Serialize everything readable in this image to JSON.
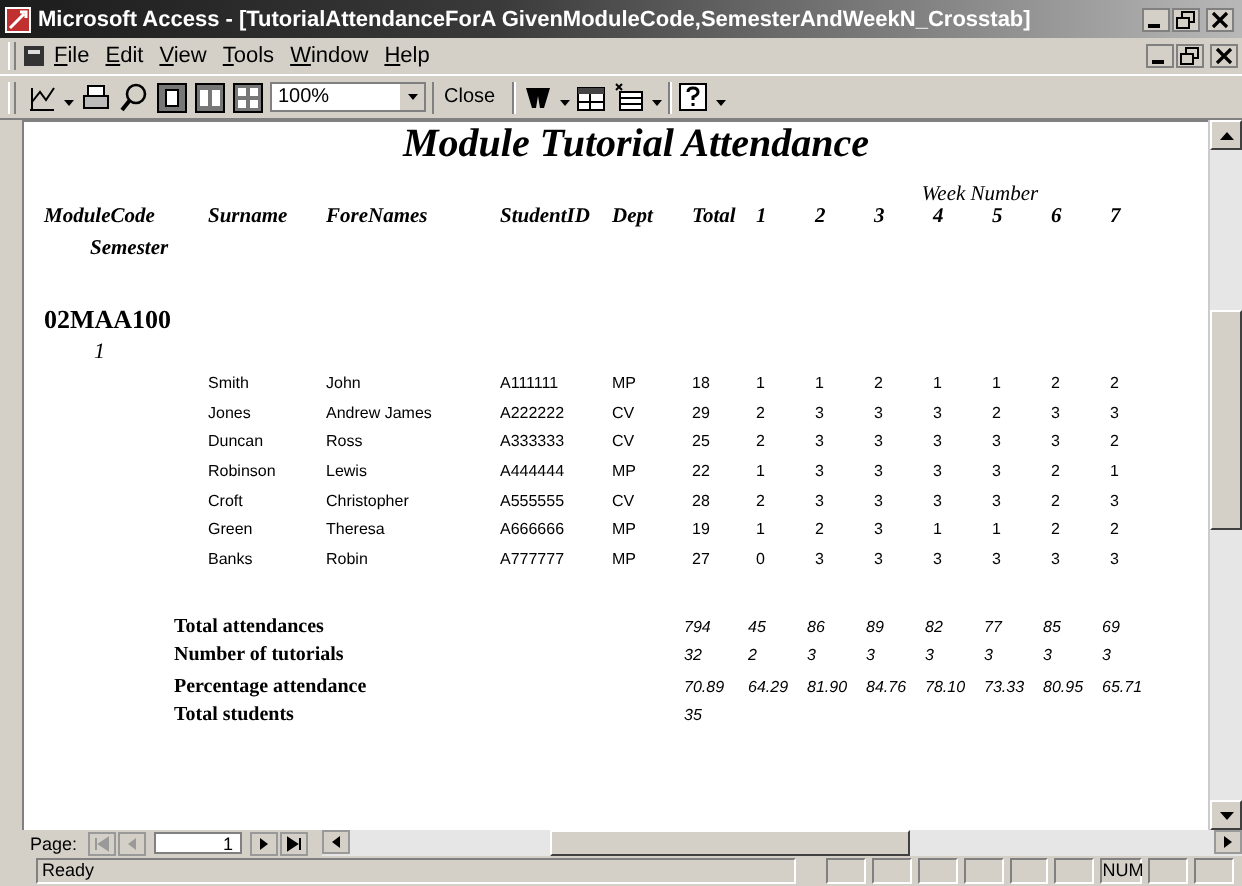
{
  "window": {
    "title": "Microsoft Access - [TutorialAttendanceForA GivenModuleCode,SemesterAndWeekN_Crosstab]"
  },
  "menu": [
    "File",
    "Edit",
    "View",
    "Tools",
    "Window",
    "Help"
  ],
  "toolbar": {
    "zoom": "100%",
    "close": "Close"
  },
  "report": {
    "title": "Module Tutorial Attendance",
    "week_heading": "Week Number",
    "columns": [
      "ModuleCode",
      "Surname",
      "ForeNames",
      "StudentID",
      "Dept",
      "Total",
      "1",
      "2",
      "3",
      "4",
      "5",
      "6",
      "7"
    ],
    "group_heading": "Semester",
    "module_code": "02MAA100",
    "semester": "1",
    "rows": [
      {
        "surname": "Smith",
        "forenames": "John",
        "student_id": "A111111",
        "dept": "MP",
        "total": "18",
        "weeks": [
          "1",
          "1",
          "2",
          "1",
          "1",
          "2",
          "2"
        ]
      },
      {
        "surname": "Jones",
        "forenames": "Andrew James",
        "student_id": "A222222",
        "dept": "CV",
        "total": "29",
        "weeks": [
          "2",
          "3",
          "3",
          "3",
          "2",
          "3",
          "3"
        ]
      },
      {
        "surname": "Duncan",
        "forenames": "Ross",
        "student_id": "A333333",
        "dept": "CV",
        "total": "25",
        "weeks": [
          "2",
          "3",
          "3",
          "3",
          "3",
          "3",
          "2"
        ]
      },
      {
        "surname": "Robinson",
        "forenames": "Lewis",
        "student_id": "A444444",
        "dept": "MP",
        "total": "22",
        "weeks": [
          "1",
          "3",
          "3",
          "3",
          "3",
          "2",
          "1"
        ]
      },
      {
        "surname": "Croft",
        "forenames": "Christopher",
        "student_id": "A555555",
        "dept": "CV",
        "total": "28",
        "weeks": [
          "2",
          "3",
          "3",
          "3",
          "3",
          "2",
          "3"
        ]
      },
      {
        "surname": "Green",
        "forenames": "Theresa",
        "student_id": "A666666",
        "dept": "MP",
        "total": "19",
        "weeks": [
          "1",
          "2",
          "3",
          "1",
          "1",
          "2",
          "2"
        ]
      },
      {
        "surname": "Banks",
        "forenames": "Robin",
        "student_id": "A777777",
        "dept": "MP",
        "total": "27",
        "weeks": [
          "0",
          "3",
          "3",
          "3",
          "3",
          "3",
          "3"
        ]
      }
    ],
    "summary": [
      {
        "label": "Total attendances",
        "values": [
          "794",
          "45",
          "86",
          "89",
          "82",
          "77",
          "85",
          "69"
        ]
      },
      {
        "label": "Number of tutorials",
        "values": [
          "32",
          "2",
          "3",
          "3",
          "3",
          "3",
          "3",
          "3"
        ]
      },
      {
        "label": "Percentage attendance",
        "values": [
          "70.89",
          "64.29",
          "81.90",
          "84.76",
          "78.10",
          "73.33",
          "80.95",
          "65.71"
        ]
      },
      {
        "label": "Total students",
        "values": [
          "35"
        ]
      }
    ]
  },
  "navigation": {
    "page_label": "Page:",
    "page": "1"
  },
  "status_bar": {
    "text": "Ready",
    "indicators": [
      "NUM"
    ]
  }
}
